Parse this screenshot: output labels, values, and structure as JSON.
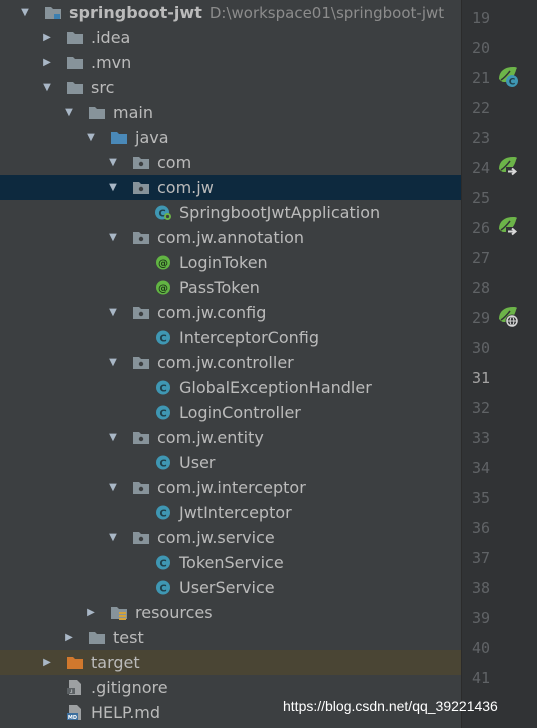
{
  "project": {
    "name": "springboot-jwt",
    "path": "D:\\workspace01\\springboot-jwt"
  },
  "tree": [
    {
      "label": "springboot-jwt",
      "icon": "module-folder-icon",
      "expanded": true,
      "depth": 0,
      "bold": true,
      "path": "D:\\workspace01\\springboot-jwt"
    },
    {
      "label": ".idea",
      "icon": "folder-icon",
      "expanded": false,
      "depth": 1
    },
    {
      "label": ".mvn",
      "icon": "folder-icon",
      "expanded": false,
      "depth": 1
    },
    {
      "label": "src",
      "icon": "folder-icon",
      "expanded": true,
      "depth": 1
    },
    {
      "label": "main",
      "icon": "folder-icon",
      "expanded": true,
      "depth": 2
    },
    {
      "label": "java",
      "icon": "source-root-icon",
      "expanded": true,
      "depth": 3
    },
    {
      "label": "com",
      "icon": "package-icon",
      "expanded": true,
      "depth": 4
    },
    {
      "label": "com.jw",
      "icon": "package-icon",
      "expanded": true,
      "depth": 4,
      "selected": true
    },
    {
      "label": "SpringbootJwtApplication",
      "icon": "spring-boot-class-icon",
      "depth": 5
    },
    {
      "label": "com.jw.annotation",
      "icon": "package-icon",
      "expanded": true,
      "depth": 4
    },
    {
      "label": "LoginToken",
      "icon": "annotation-icon",
      "depth": 5
    },
    {
      "label": "PassToken",
      "icon": "annotation-icon",
      "depth": 5
    },
    {
      "label": "com.jw.config",
      "icon": "package-icon",
      "expanded": true,
      "depth": 4
    },
    {
      "label": "InterceptorConfig",
      "icon": "class-icon",
      "depth": 5
    },
    {
      "label": "com.jw.controller",
      "icon": "package-icon",
      "expanded": true,
      "depth": 4
    },
    {
      "label": "GlobalExceptionHandler",
      "icon": "class-icon",
      "depth": 5
    },
    {
      "label": "LoginController",
      "icon": "class-icon",
      "depth": 5
    },
    {
      "label": "com.jw.entity",
      "icon": "package-icon",
      "expanded": true,
      "depth": 4
    },
    {
      "label": "User",
      "icon": "class-icon",
      "depth": 5
    },
    {
      "label": "com.jw.interceptor",
      "icon": "package-icon",
      "expanded": true,
      "depth": 4
    },
    {
      "label": "JwtInterceptor",
      "icon": "class-icon",
      "depth": 5
    },
    {
      "label": "com.jw.service",
      "icon": "package-icon",
      "expanded": true,
      "depth": 4
    },
    {
      "label": "TokenService",
      "icon": "class-icon",
      "depth": 5
    },
    {
      "label": "UserService",
      "icon": "class-icon",
      "depth": 5
    },
    {
      "label": "resources",
      "icon": "resources-folder-icon",
      "expanded": false,
      "depth": 3
    },
    {
      "label": "test",
      "icon": "folder-icon",
      "expanded": false,
      "depth": 2
    },
    {
      "label": "target",
      "icon": "excluded-folder-icon",
      "expanded": false,
      "depth": 1,
      "excluded": true
    },
    {
      "label": ".gitignore",
      "icon": "gitignore-file-icon",
      "depth": 1
    },
    {
      "label": "HELP.md",
      "icon": "markdown-file-icon",
      "depth": 1
    }
  ],
  "line_numbers": [
    "19",
    "20",
    "21",
    "22",
    "23",
    "24",
    "25",
    "26",
    "27",
    "28",
    "29",
    "30",
    "31",
    "32",
    "33",
    "34",
    "35",
    "36",
    "37",
    "38",
    "39",
    "40",
    "41"
  ],
  "current_line": "31",
  "gutter_icons": [
    {
      "line": "21",
      "icon": "spring-bean-class-icon"
    },
    {
      "line": "24",
      "icon": "spring-request-mapping-icon"
    },
    {
      "line": "26",
      "icon": "spring-request-mapping-icon"
    },
    {
      "line": "29",
      "icon": "spring-web-endpoint-icon"
    }
  ],
  "watermark": "https://blog.csdn.net/qq_39221436",
  "colors": {
    "background": "#3c3f41",
    "selection": "#0d293e",
    "excluded": "#4a4534",
    "folder": "#87939a",
    "class": "#3f97b3",
    "annotation": "#62b543",
    "spring": "#6cb449"
  }
}
